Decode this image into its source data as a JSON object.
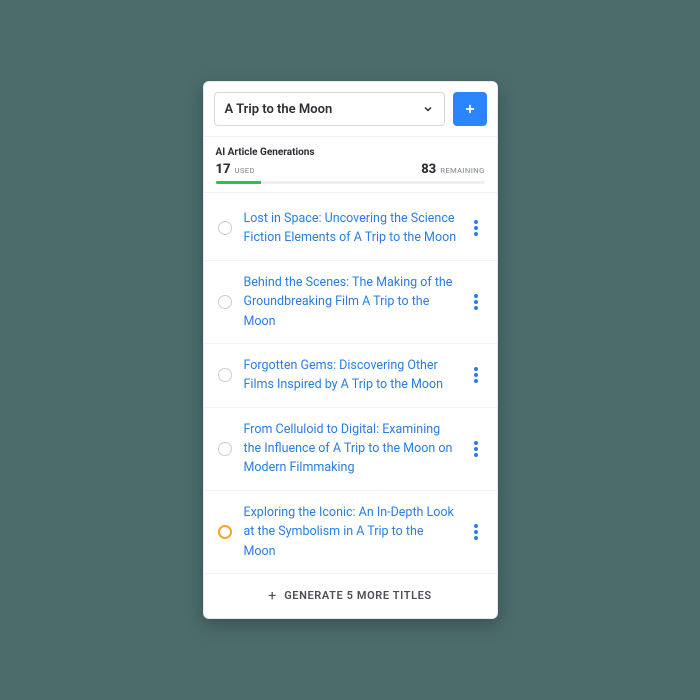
{
  "header": {
    "selected_project": "A Trip to the Moon"
  },
  "usage": {
    "title": "AI Article Generations",
    "used": "17",
    "used_label": "Used",
    "remaining": "83",
    "remaining_label": "Remaining",
    "pct": 17
  },
  "items": [
    {
      "title": "Lost in Space: Uncovering the Science Fiction Elements of A Trip to the Moon",
      "active": false
    },
    {
      "title": "Behind the Scenes: The Making of the Groundbreaking Film A Trip to the Moon",
      "active": false
    },
    {
      "title": "Forgotten Gems: Discovering Other Films Inspired by A Trip to the Moon",
      "active": false
    },
    {
      "title": "From Celluloid to Digital: Examining the Influence of A Trip to the Moon on Modern Filmmaking",
      "active": false
    },
    {
      "title": "Exploring the Iconic: An In-Depth Look at the Symbolism in A Trip to the Moon",
      "active": true
    }
  ],
  "footer": {
    "label": "GENERATE 5 MORE TITLES"
  }
}
